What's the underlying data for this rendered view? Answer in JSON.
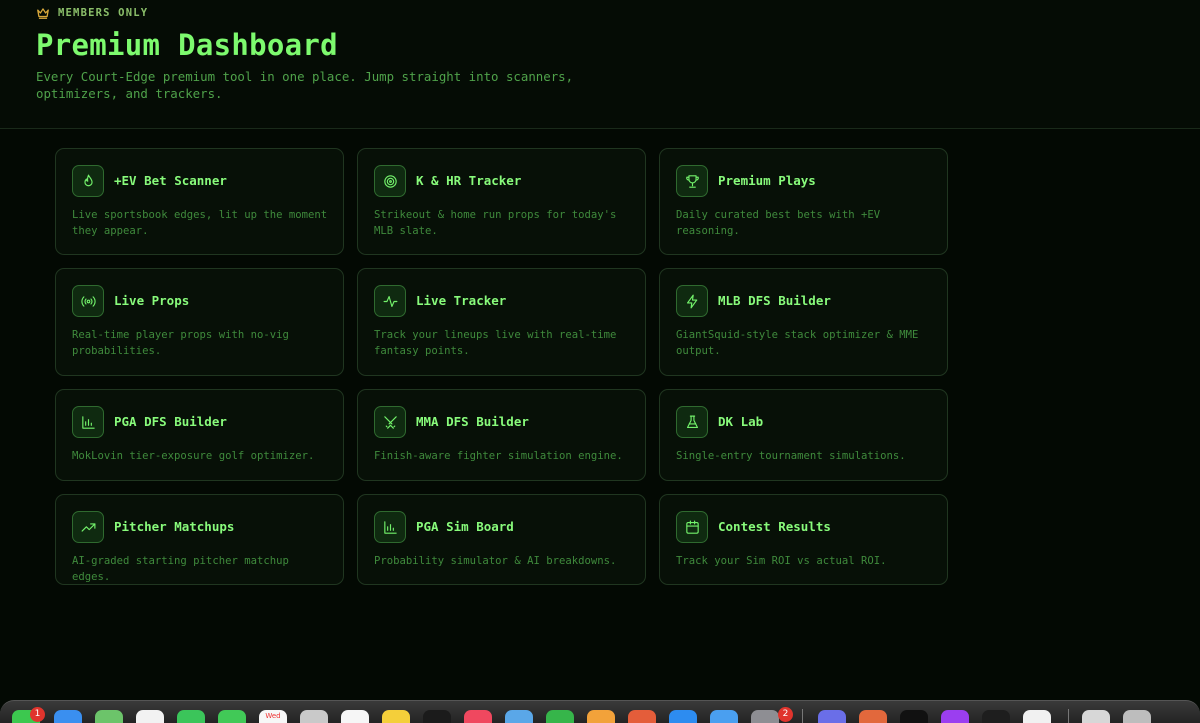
{
  "header": {
    "badge_label": "MEMBERS ONLY",
    "badge_icon": "crown-icon",
    "title": "Premium Dashboard",
    "subtitle": "Every Court-Edge premium tool in one place. Jump straight into scanners, optimizers, and trackers."
  },
  "cards": [
    {
      "title": "+EV Bet Scanner",
      "desc": "Live sportsbook edges, lit up the moment they appear.",
      "icon": "flame-icon"
    },
    {
      "title": "K & HR Tracker",
      "desc": "Strikeout & home run props for today's MLB slate.",
      "icon": "target-icon"
    },
    {
      "title": "Premium Plays",
      "desc": "Daily curated best bets with +EV reasoning.",
      "icon": "trophy-icon"
    },
    {
      "title": "Live Props",
      "desc": "Real-time player props with no-vig probabilities.",
      "icon": "broadcast-icon"
    },
    {
      "title": "Live Tracker",
      "desc": "Track your lineups live with real-time fantasy points.",
      "icon": "activity-icon"
    },
    {
      "title": "MLB DFS Builder",
      "desc": "GiantSquid-style stack optimizer & MME output.",
      "icon": "lightning-icon"
    },
    {
      "title": "PGA DFS Builder",
      "desc": "MokLovin tier-exposure golf optimizer.",
      "icon": "bar-chart-icon"
    },
    {
      "title": "MMA DFS Builder",
      "desc": "Finish-aware fighter simulation engine.",
      "icon": "crossed-swords-icon"
    },
    {
      "title": "DK Lab",
      "desc": "Single-entry tournament simulations.",
      "icon": "flask-icon"
    },
    {
      "title": "Pitcher Matchups",
      "desc": "AI-graded starting pitcher matchup edges.",
      "icon": "trending-up-icon"
    },
    {
      "title": "PGA Sim Board",
      "desc": "Probability simulator & AI breakdowns.",
      "icon": "bar-chart-icon"
    },
    {
      "title": "Contest Results",
      "desc": "Track your Sim ROI vs actual ROI.",
      "icon": "calendar-icon"
    }
  ],
  "dock": {
    "messages_badge": "1",
    "calendar_day": "Wed",
    "settings_badge": "2"
  },
  "colors": {
    "accent": "#7dfa6e",
    "background": "#030903",
    "card_border": "#203620",
    "muted_text": "#3f8a3c"
  }
}
